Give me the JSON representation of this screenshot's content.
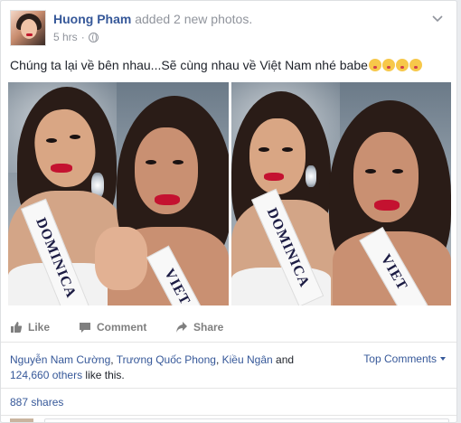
{
  "post": {
    "author": "Huong Pham",
    "action_text": "added 2 new photos.",
    "timestamp": "5 hrs",
    "separator": "·",
    "caption": "Chúng ta lại về bên nhau...Sẽ cùng nhau về Việt Nam nhé babe",
    "emoji_icon": "kissing-face-emoji",
    "emoji_count": 4
  },
  "photos": [
    {
      "sash_text": "DOMINICA"
    },
    {
      "sash_text": "DOMINICA"
    }
  ],
  "photos_right_sash": [
    {
      "sash_text": "VIET"
    },
    {
      "sash_text": "VIET"
    }
  ],
  "actions": {
    "like_label": "Like",
    "comment_label": "Comment",
    "share_label": "Share"
  },
  "likes": {
    "name1": "Nguyễn Nam Cường",
    "name2": "Trương Quốc Phong",
    "name3": "Kiều Ngân",
    "and": "and",
    "others": "124,660 others",
    "suffix": "like this.",
    "comma": ","
  },
  "top_comments_label": "Top Comments",
  "shares_label": "887 shares",
  "colors": {
    "link": "#365899",
    "meta": "#90949c",
    "border": "#dddfe2"
  }
}
